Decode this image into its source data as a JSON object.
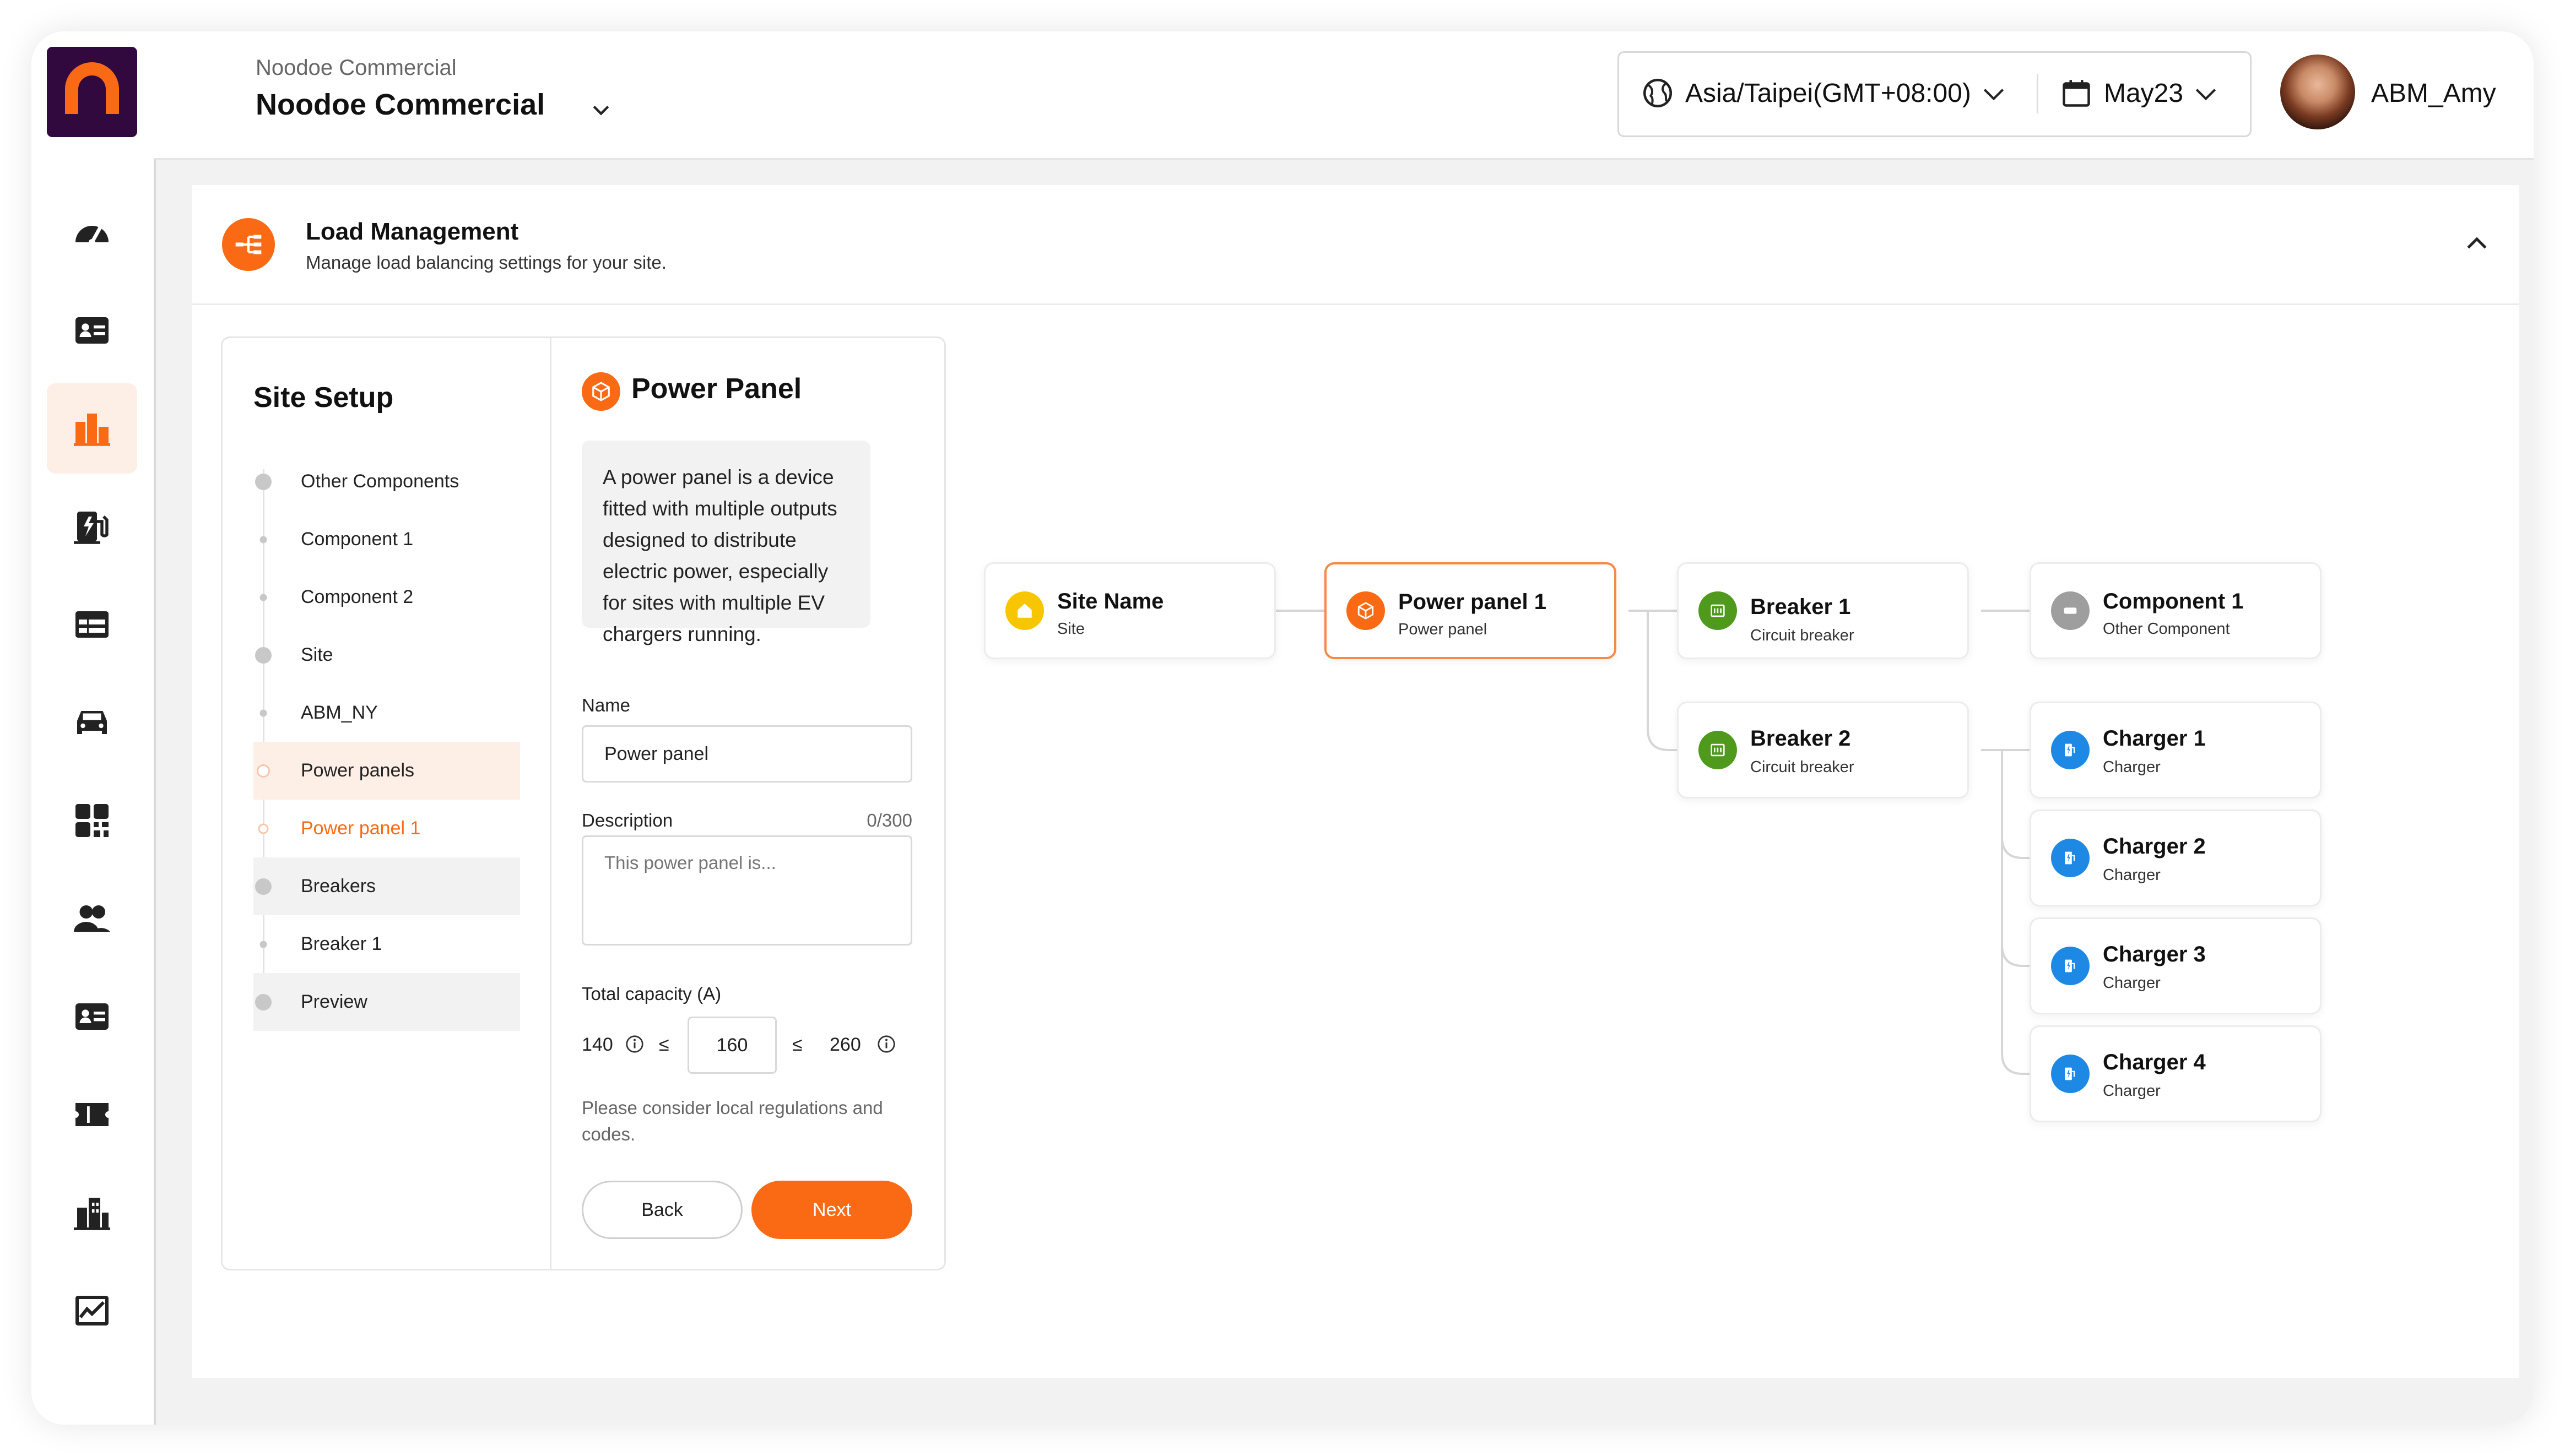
{
  "app": {
    "brand_color": "#32093f",
    "accent_color": "#fa6a14"
  },
  "sidebar": {
    "items": [
      {
        "name": "dashboard-icon"
      },
      {
        "name": "id-card-icon"
      },
      {
        "name": "building-chart-icon",
        "active": true
      },
      {
        "name": "ev-station-icon"
      },
      {
        "name": "table-icon"
      },
      {
        "name": "car-icon"
      },
      {
        "name": "qr-code-icon"
      },
      {
        "name": "users-icon"
      },
      {
        "name": "contact-card-icon"
      },
      {
        "name": "ticket-icon"
      },
      {
        "name": "office-building-icon"
      },
      {
        "name": "line-chart-icon"
      }
    ]
  },
  "header": {
    "org_subtitle": "Noodoe Commercial",
    "org_title": "Noodoe Commercial",
    "timezone": "Asia/Taipei(GMT+08:00)",
    "date": "May23",
    "username": "ABM_Amy"
  },
  "section": {
    "title": "Load Management",
    "description": "Manage load balancing settings for your site."
  },
  "setup": {
    "title": "Site Setup",
    "steps": [
      {
        "label": "Other Components"
      },
      {
        "label": "Component 1"
      },
      {
        "label": "Component 2"
      },
      {
        "label": "Site"
      },
      {
        "label": "ABM_NY"
      },
      {
        "label": "Power panels"
      },
      {
        "label": "Power panel 1"
      },
      {
        "label": "Breakers"
      },
      {
        "label": "Breaker 1"
      },
      {
        "label": "Preview"
      }
    ]
  },
  "form": {
    "title": "Power Panel",
    "description": "A power panel is a device fitted with multiple outputs designed to distribute electric power, especially for sites with multiple EV chargers running.",
    "name_label": "Name",
    "name_value": "Power panel",
    "desc_label": "Description",
    "desc_count": "0/300",
    "desc_placeholder": "This power panel is...",
    "capacity_label": "Total capacity (A)",
    "capacity_min": "140",
    "capacity_value": "160",
    "capacity_max": "260",
    "leq": "≤",
    "note": "Please consider local regulations and codes.",
    "back_label": "Back",
    "next_label": "Next"
  },
  "tree": {
    "nodes": [
      {
        "title": "Site Name",
        "subtitle": "Site",
        "icon": "home-icon",
        "color": "#f7c600"
      },
      {
        "title": "Power panel 1",
        "subtitle": "Power panel",
        "icon": "cube-icon",
        "color": "#fa6a14"
      },
      {
        "title": "Breaker 1",
        "subtitle": "Circuit breaker",
        "icon": "breaker-icon",
        "color": "#4f9a1c"
      },
      {
        "title": "Breaker 2",
        "subtitle": "Circuit breaker",
        "icon": "breaker-icon",
        "color": "#4f9a1c"
      },
      {
        "title": "Component 1",
        "subtitle": "Other Component",
        "icon": "component-icon",
        "color": "#9e9e9e"
      },
      {
        "title": "Charger 1",
        "subtitle": "Charger",
        "icon": "charger-icon",
        "color": "#1e88e5"
      },
      {
        "title": "Charger 2",
        "subtitle": "Charger",
        "icon": "charger-icon",
        "color": "#1e88e5"
      },
      {
        "title": "Charger 3",
        "subtitle": "Charger",
        "icon": "charger-icon",
        "color": "#1e88e5"
      },
      {
        "title": "Charger 4",
        "subtitle": "Charger",
        "icon": "charger-icon",
        "color": "#1e88e5"
      }
    ]
  }
}
